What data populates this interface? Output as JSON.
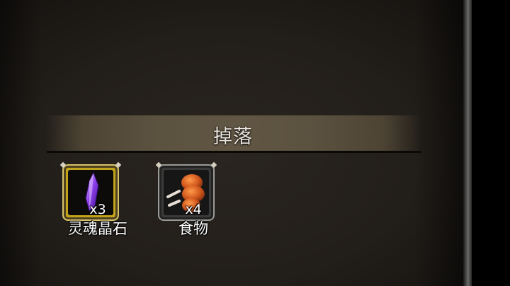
{
  "drop_panel": {
    "title": "掉落",
    "items": [
      {
        "name": "灵魂晶石",
        "count": "x3",
        "icon": "soul-crystal-icon",
        "rarity_color": "#c2a41a"
      },
      {
        "name": "食物",
        "count": "x4",
        "icon": "roast-meat-icon",
        "rarity_color": "#9a9a96"
      }
    ]
  }
}
